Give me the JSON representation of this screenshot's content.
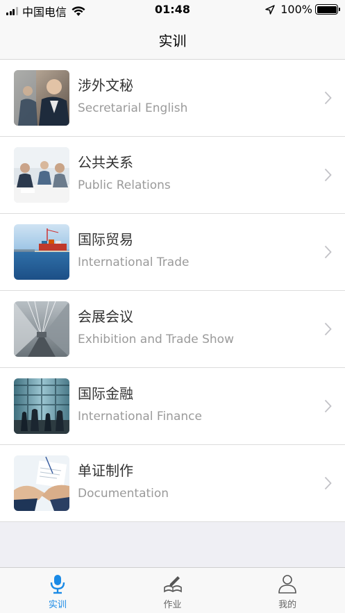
{
  "status_bar": {
    "carrier": "中国电信",
    "time": "01:48",
    "battery": "100%"
  },
  "header": {
    "title": "实训"
  },
  "courses": [
    {
      "title": "涉外文秘",
      "subtitle": "Secretarial English"
    },
    {
      "title": "公共关系",
      "subtitle": "Public Relations"
    },
    {
      "title": "国际贸易",
      "subtitle": "International Trade"
    },
    {
      "title": "会展会议",
      "subtitle": "Exhibition and Trade Show"
    },
    {
      "title": "国际金融",
      "subtitle": "International Finance"
    },
    {
      "title": "单证制作",
      "subtitle": "Documentation"
    }
  ],
  "tabs": [
    {
      "label": "实训",
      "icon": "microphone-icon",
      "active": true
    },
    {
      "label": "作业",
      "icon": "notebook-pen-icon",
      "active": false
    },
    {
      "label": "我的",
      "icon": "person-icon",
      "active": false
    }
  ],
  "colors": {
    "accent": "#1a8ae6",
    "background": "#efeff4"
  }
}
